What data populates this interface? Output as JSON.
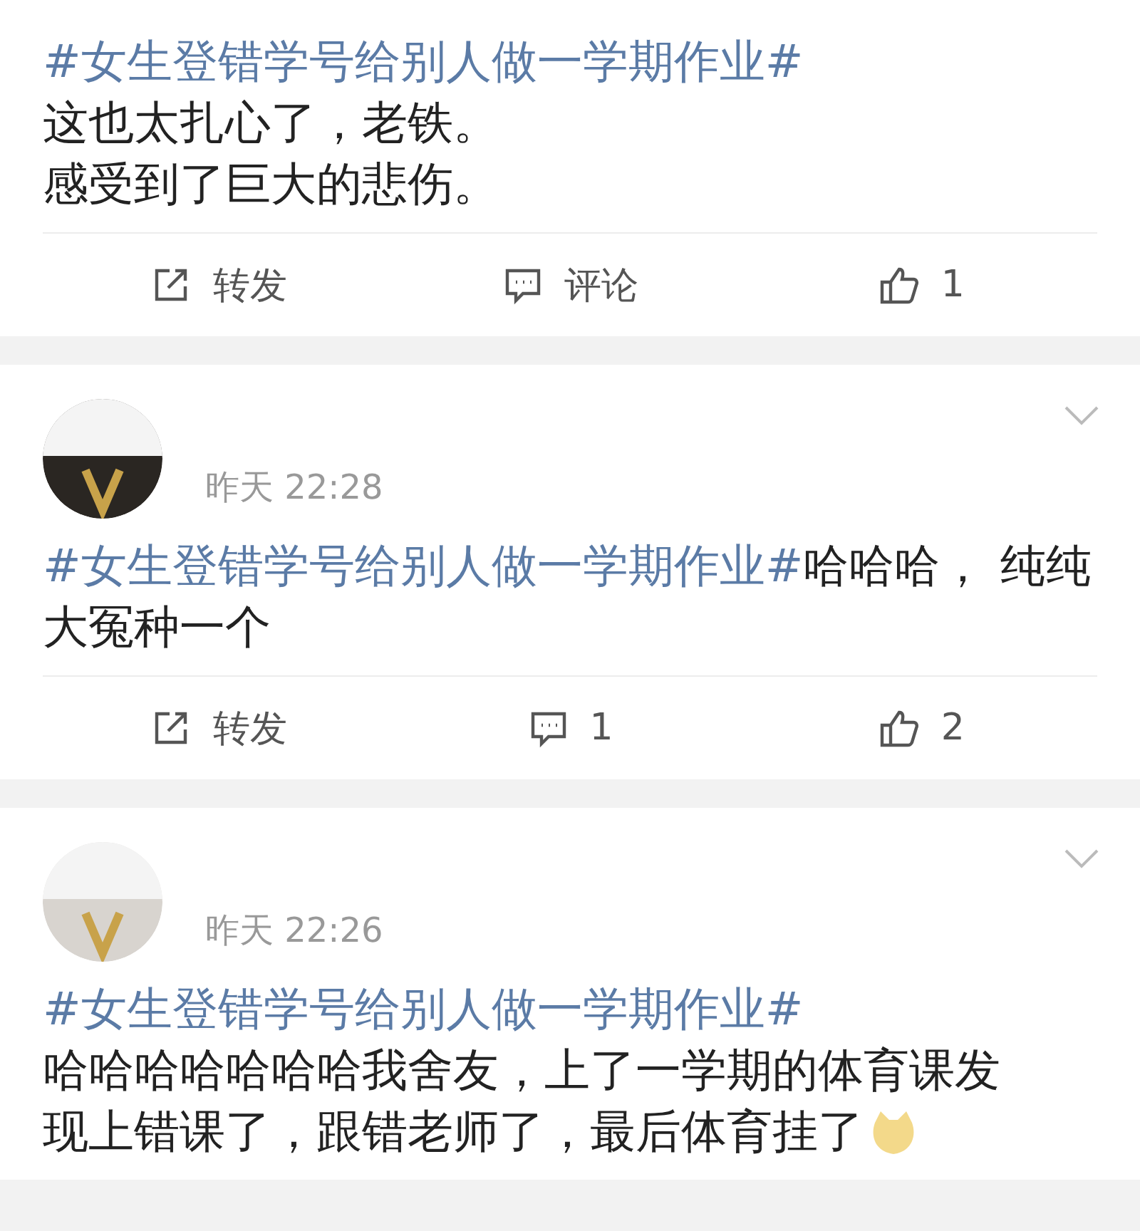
{
  "posts": [
    {
      "paragraphs": [
        {
          "hashtag": "#女生登错学号给别人做一学期作业#"
        },
        {
          "text": "这也太扎心了，老铁。"
        },
        {
          "text": "感受到了巨大的悲伤。"
        }
      ],
      "actions": [
        {
          "kind": "share",
          "label": "转发"
        },
        {
          "kind": "comment",
          "label": "评论"
        },
        {
          "kind": "like",
          "label": "1"
        }
      ]
    },
    {
      "header": {
        "time": "昨天 22:28"
      },
      "paragraphs": [
        {
          "hashtag": "#女生登错学号给别人做一学期作业#",
          "text": "哈哈哈， 纯纯大冤种一个"
        }
      ],
      "actions": [
        {
          "kind": "share",
          "label": "转发"
        },
        {
          "kind": "comment",
          "label": "1"
        },
        {
          "kind": "like",
          "label": "2"
        }
      ]
    },
    {
      "header": {
        "time": "昨天 22:26"
      },
      "paragraphs": [
        {
          "hashtag": "#女生登错学号给别人做一学期作业#"
        },
        {
          "text": "哈哈哈哈哈哈哈我舍友，上了一学期的体育课发"
        },
        {
          "text": "现上错课了，跟错老师了，最后体育挂了",
          "emoji": true
        }
      ]
    }
  ]
}
